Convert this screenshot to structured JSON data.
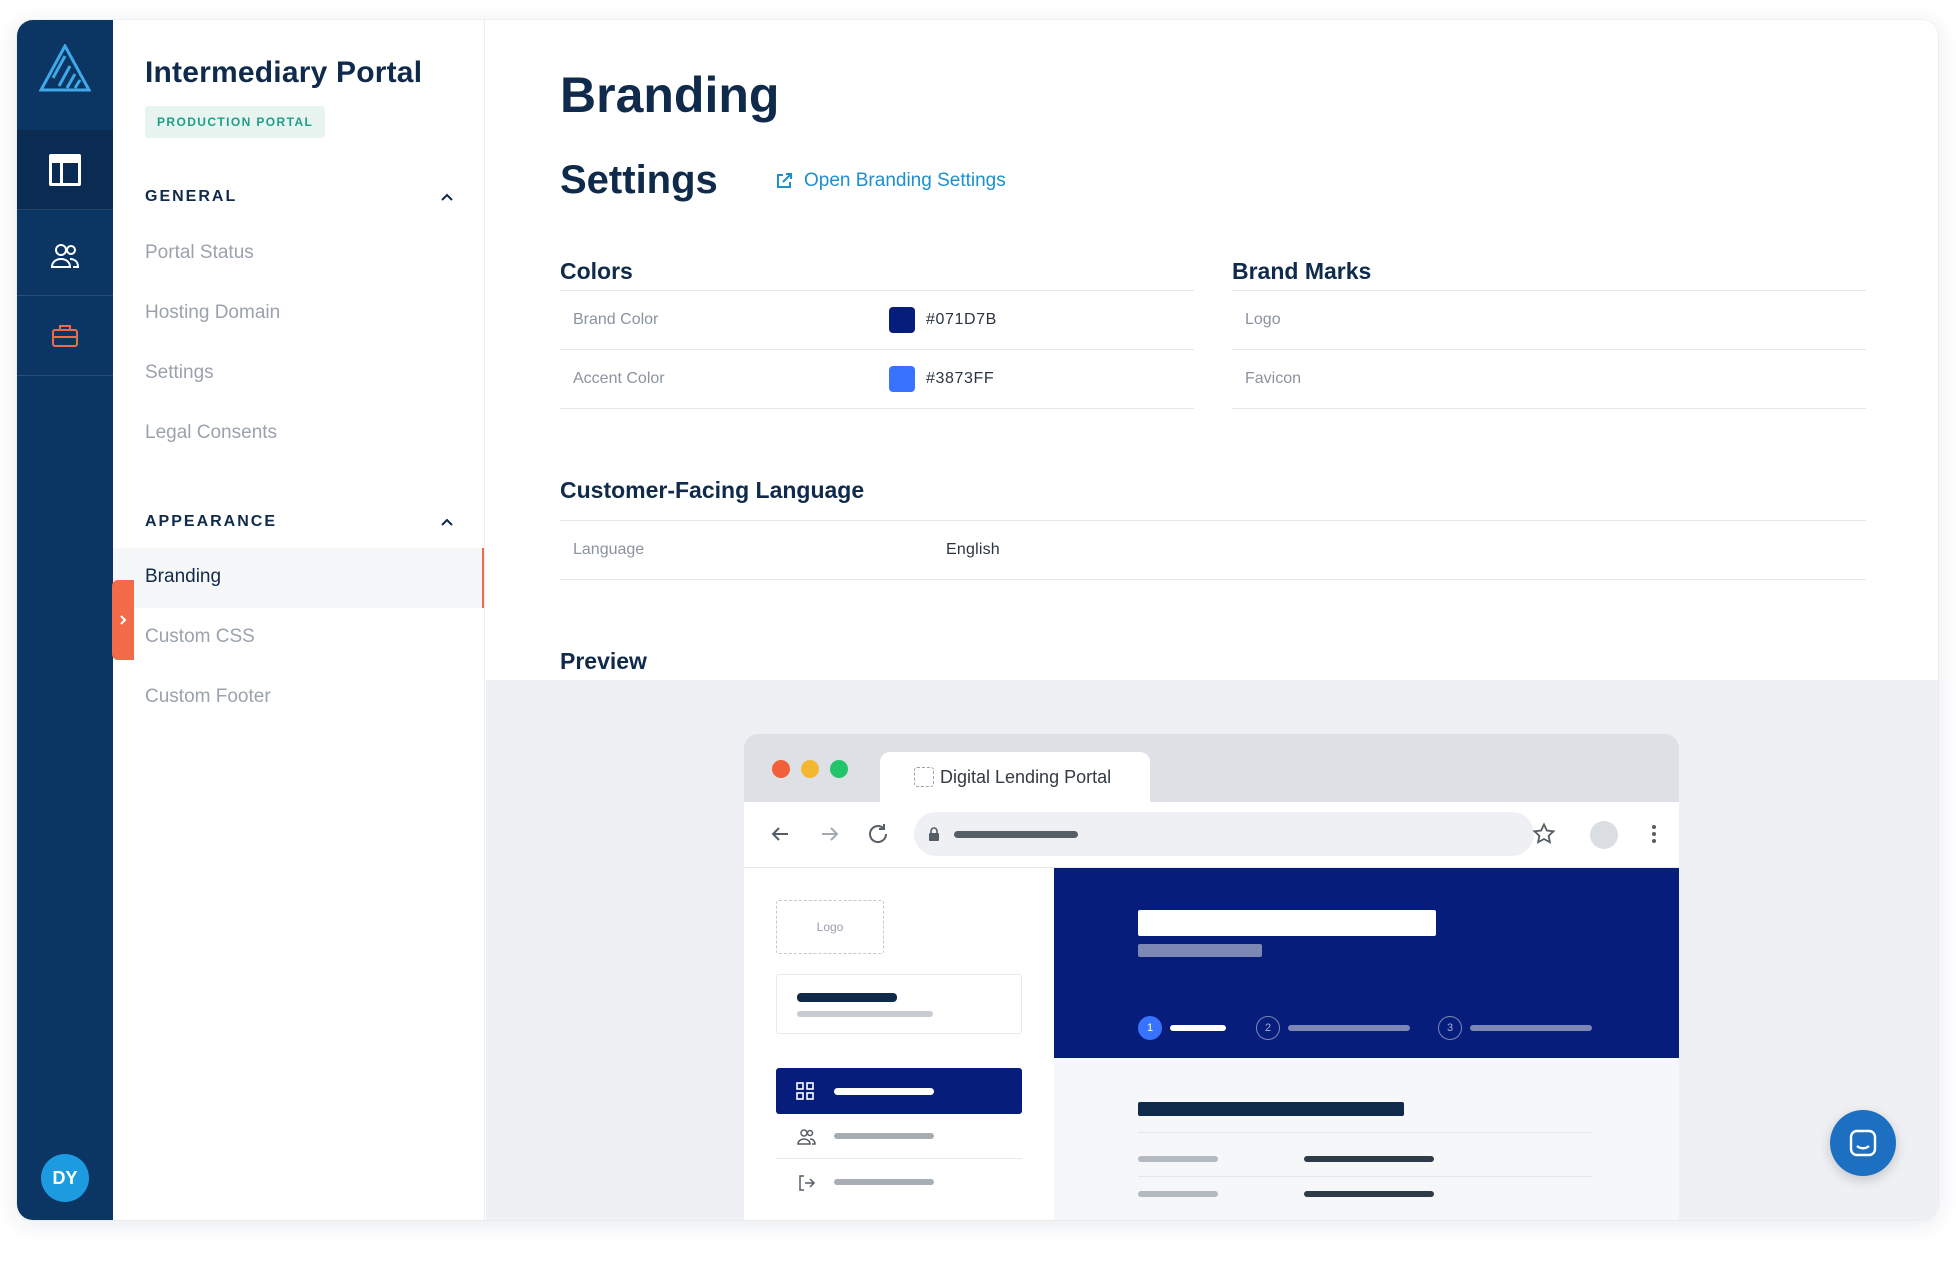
{
  "sidebar": {
    "title": "Intermediary Portal",
    "badge": "PRODUCTION PORTAL",
    "sections": [
      {
        "label": "GENERAL",
        "items": [
          "Portal Status",
          "Hosting Domain",
          "Settings",
          "Legal Consents"
        ]
      },
      {
        "label": "APPEARANCE",
        "items": [
          "Branding",
          "Custom CSS",
          "Custom Footer"
        ]
      }
    ],
    "active_item": "Branding"
  },
  "rail": {
    "avatar_initials": "DY",
    "icons": [
      "logo-icon",
      "layout-icon",
      "users-icon",
      "briefcase-icon"
    ]
  },
  "main": {
    "page_title": "Branding",
    "settings_title": "Settings",
    "open_link_label": "Open Branding Settings",
    "colors": {
      "title": "Colors",
      "rows": [
        {
          "label": "Brand Color",
          "value": "#071D7B",
          "swatch": "#071d7b"
        },
        {
          "label": "Accent Color",
          "value": "#3873FF",
          "swatch": "#3873ff"
        }
      ]
    },
    "brand_marks": {
      "title": "Brand Marks",
      "rows": [
        {
          "label": "Logo"
        },
        {
          "label": "Favicon"
        }
      ]
    },
    "language": {
      "title": "Customer-Facing Language",
      "label": "Language",
      "value": "English"
    },
    "preview_title": "Preview"
  },
  "preview": {
    "tab_title": "Digital Lending Portal",
    "logo_placeholder": "Logo",
    "steps": [
      "1",
      "2",
      "3"
    ]
  },
  "colors": {
    "rail_bg": "#0b3563",
    "accent": "#f26a47",
    "link": "#1d8fcf",
    "brand": "#071d7b",
    "accent_brand": "#3873ff"
  }
}
